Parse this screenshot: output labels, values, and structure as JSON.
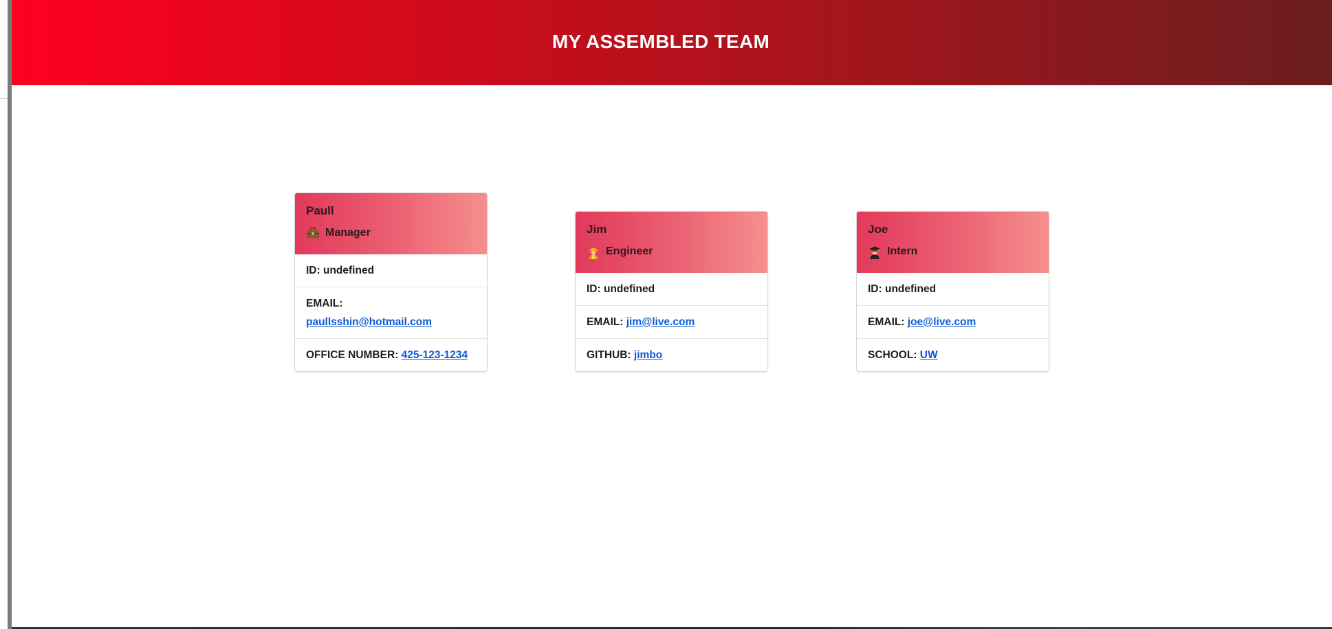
{
  "header": {
    "title": "MY ASSEMBLED TEAM"
  },
  "colors": {
    "header_gradient": [
      "#ff0020",
      "#6a1e1e"
    ],
    "card_gradient": [
      "#e2395a",
      "#f58f8e"
    ],
    "link": "#0d59d6"
  },
  "cards": [
    {
      "name": "Paull",
      "role": "Manager",
      "role_icon": "briefcase-icon",
      "id_label": "ID:",
      "id_value": "undefined",
      "email_label": "EMAIL:",
      "email_value": "paullsshin@hotmail.com",
      "extra_label": "OFFICE NUMBER:",
      "extra_value": "425-123-1234"
    },
    {
      "name": "Jim",
      "role": "Engineer",
      "role_icon": "construction-worker-icon",
      "id_label": "ID:",
      "id_value": "undefined",
      "email_label": "EMAIL:",
      "email_value": "jim@live.com",
      "extra_label": "GITHUB:",
      "extra_value": "jimbo"
    },
    {
      "name": "Joe",
      "role": "Intern",
      "role_icon": "student-icon",
      "id_label": "ID:",
      "id_value": "undefined",
      "email_label": "EMAIL:",
      "email_value": "joe@live.com",
      "extra_label": "SCHOOL:",
      "extra_value": "UW"
    }
  ]
}
